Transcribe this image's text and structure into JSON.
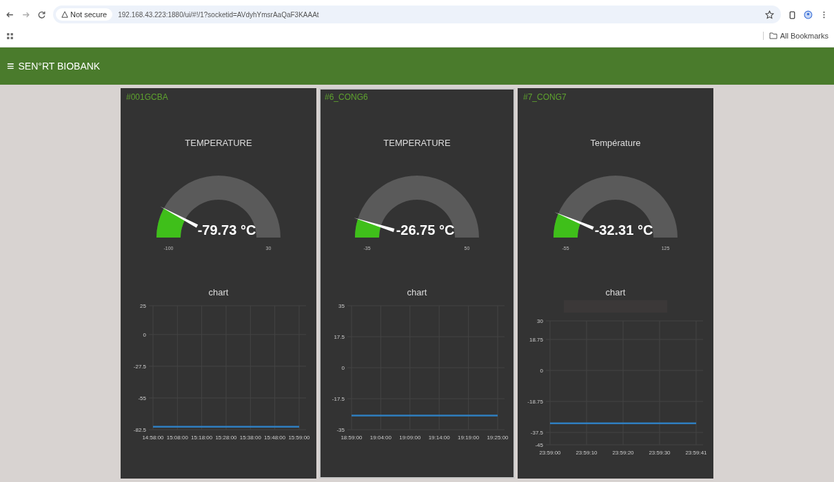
{
  "browser": {
    "security_label": "Not secure",
    "url": "192.168.43.223:1880/ui/#!/1?socketid=AVdyhYmsrAaQaF3KAAAt",
    "bookmarks_label": "All Bookmarks"
  },
  "header": {
    "menu_glyph": "≡",
    "title": "SEN°RT BIOBANK"
  },
  "cards": [
    {
      "name": "#001GCBA",
      "selected": false,
      "gauge": {
        "title": "TEMPERATURE",
        "value": "-79.73 °C",
        "level": 0.156,
        "min": "-100",
        "max": "30"
      },
      "chart_title": "chart",
      "legend_bar": false,
      "chart_data": {
        "type": "line",
        "categories": [
          "14:58:00",
          "15:08:00",
          "15:18:00",
          "15:28:00",
          "15:38:00",
          "15:48:00",
          "15:59:00"
        ],
        "series": [
          {
            "color": "#2f7fc1",
            "values": [
              -80,
              -80,
              -80,
              -80,
              -80,
              -80,
              -80
            ]
          }
        ],
        "grid": true,
        "ylim": [
          -82.5,
          25
        ],
        "yticks": [
          25,
          0,
          -27.5,
          -55,
          -82.5
        ]
      }
    },
    {
      "name": "#6_CONG6",
      "selected": true,
      "gauge": {
        "title": "TEMPERATURE",
        "value": "-26.75 °C",
        "level": 0.097,
        "min": "-35",
        "max": "50"
      },
      "chart_title": "chart",
      "legend_bar": false,
      "chart_data": {
        "type": "line",
        "categories": [
          "18:59:00",
          "19:04:00",
          "19:09:00",
          "19:14:00",
          "19:19:00",
          "19:25:00"
        ],
        "series": [
          {
            "color": "#2f7fc1",
            "values": [
              -27,
              -27,
              -27,
              -27,
              -27,
              -27
            ]
          }
        ],
        "grid": true,
        "ylim": [
          -35,
          35
        ],
        "yticks": [
          35,
          17.5,
          0,
          -17.5,
          -35
        ]
      }
    },
    {
      "name": "#7_CONG7",
      "selected": false,
      "gauge": {
        "title": "Température",
        "value": "-32.31 °C",
        "level": 0.126,
        "min": "-55",
        "max": "125"
      },
      "chart_title": "chart",
      "legend_bar": true,
      "chart_data": {
        "type": "line",
        "categories": [
          "23:59:00",
          "23:59:10",
          "23:59:20",
          "23:59:30",
          "23:59:41"
        ],
        "series": [
          {
            "color": "#2f7fc1",
            "values": [
              -32,
              -32,
              -32,
              -32,
              -32
            ]
          }
        ],
        "grid": true,
        "ylim": [
          -45,
          30
        ],
        "yticks": [
          30,
          18.75,
          0,
          -18.75,
          -37.5,
          -45
        ]
      }
    }
  ]
}
